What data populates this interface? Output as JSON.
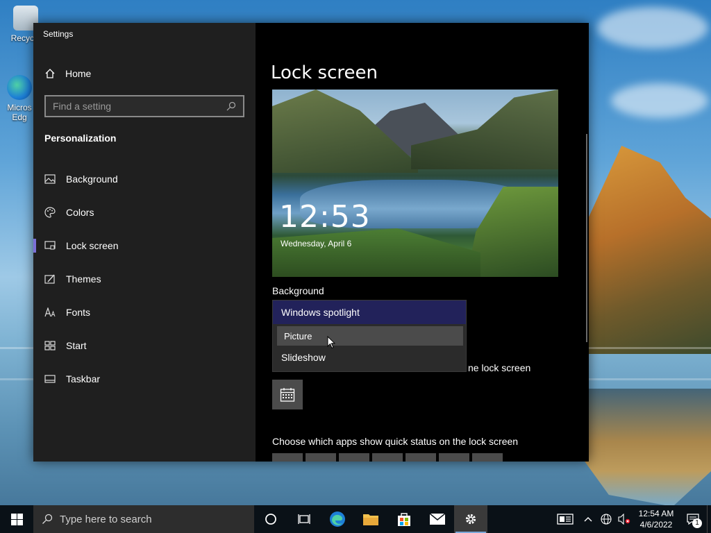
{
  "desktop": {
    "icons": [
      {
        "label": "Recycle",
        "icon": "recycle-bin-icon"
      },
      {
        "label": "Micros Edg",
        "icon": "edge-icon"
      }
    ]
  },
  "window": {
    "title": "Settings",
    "controls": {
      "minimize": "minimize-icon",
      "maximize": "maximize-icon",
      "close": "close-icon"
    }
  },
  "sidebar": {
    "home_label": "Home",
    "search_placeholder": "Find a setting",
    "section_label": "Personalization",
    "items": [
      {
        "label": "Background",
        "icon": "picture-icon",
        "active": false
      },
      {
        "label": "Colors",
        "icon": "palette-icon",
        "active": false
      },
      {
        "label": "Lock screen",
        "icon": "lock-screen-icon",
        "active": true
      },
      {
        "label": "Themes",
        "icon": "themes-icon",
        "active": false
      },
      {
        "label": "Fonts",
        "icon": "fonts-icon",
        "active": false
      },
      {
        "label": "Start",
        "icon": "start-icon",
        "active": false
      },
      {
        "label": "Taskbar",
        "icon": "taskbar-icon",
        "active": false
      }
    ]
  },
  "content": {
    "page_title": "Lock screen",
    "preview": {
      "time": "12:53",
      "date": "Wednesday, April 6"
    },
    "background_label": "Background",
    "dropdown": {
      "options": [
        "Windows spotlight",
        "Picture",
        "Slideshow"
      ],
      "selected": "Windows spotlight",
      "hovered": "Picture"
    },
    "partial_text": "ne lock screen",
    "quick_status_label": "Choose which apps show quick status on the lock screen"
  },
  "taskbar": {
    "search_placeholder": "Type here to search",
    "clock_time": "12:54 AM",
    "clock_date": "4/6/2022",
    "notification_count": "1"
  },
  "colors": {
    "accent": "#7b6fd6",
    "dropdown_selected": "#22225a",
    "sidebar_bg": "#1f1f1f",
    "content_bg": "#000000"
  }
}
